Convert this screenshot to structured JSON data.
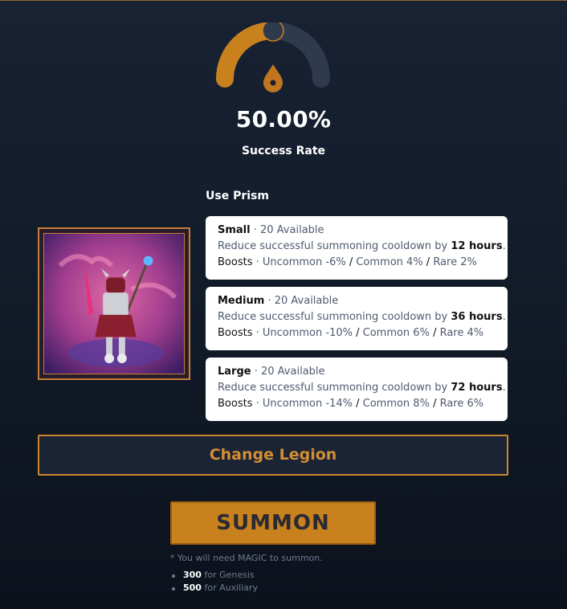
{
  "summary": {
    "success_rate": "50.00%",
    "success_rate_label": "Success Rate",
    "success_rate_fraction": 0.5,
    "colors": {
      "accent": "#c8811d",
      "gauge_track": "#2f3a4f",
      "background": "#111a27"
    }
  },
  "prism": {
    "heading": "Use Prism",
    "separator": " · ",
    "cooldown_text": "Reduce successful summoning cooldown by ",
    "boosts_label": "Boosts",
    "options": [
      {
        "size": "Small",
        "available": "20 Available",
        "hours": "12 hours",
        "uncommon": "Uncommon -6%",
        "common": "Common 4%",
        "rare": "Rare 2%"
      },
      {
        "size": "Medium",
        "available": "20 Available",
        "hours": "36 hours",
        "uncommon": "Uncommon -10%",
        "common": "Common 6%",
        "rare": "Rare 4%"
      },
      {
        "size": "Large",
        "available": "20 Available",
        "hours": "72 hours",
        "uncommon": "Uncommon -14%",
        "common": "Common 8%",
        "rare": "Rare 6%"
      }
    ]
  },
  "actions": {
    "change_legion": "Change Legion",
    "summon": "SUMMON"
  },
  "footer": {
    "note": "* You will need MAGIC to summon.",
    "requirements": [
      {
        "amount": "300",
        "label": "for Genesis"
      },
      {
        "amount": "500",
        "label": "for Auxiliary"
      }
    ]
  },
  "legion": {
    "icon": "legion-character-portrait"
  }
}
